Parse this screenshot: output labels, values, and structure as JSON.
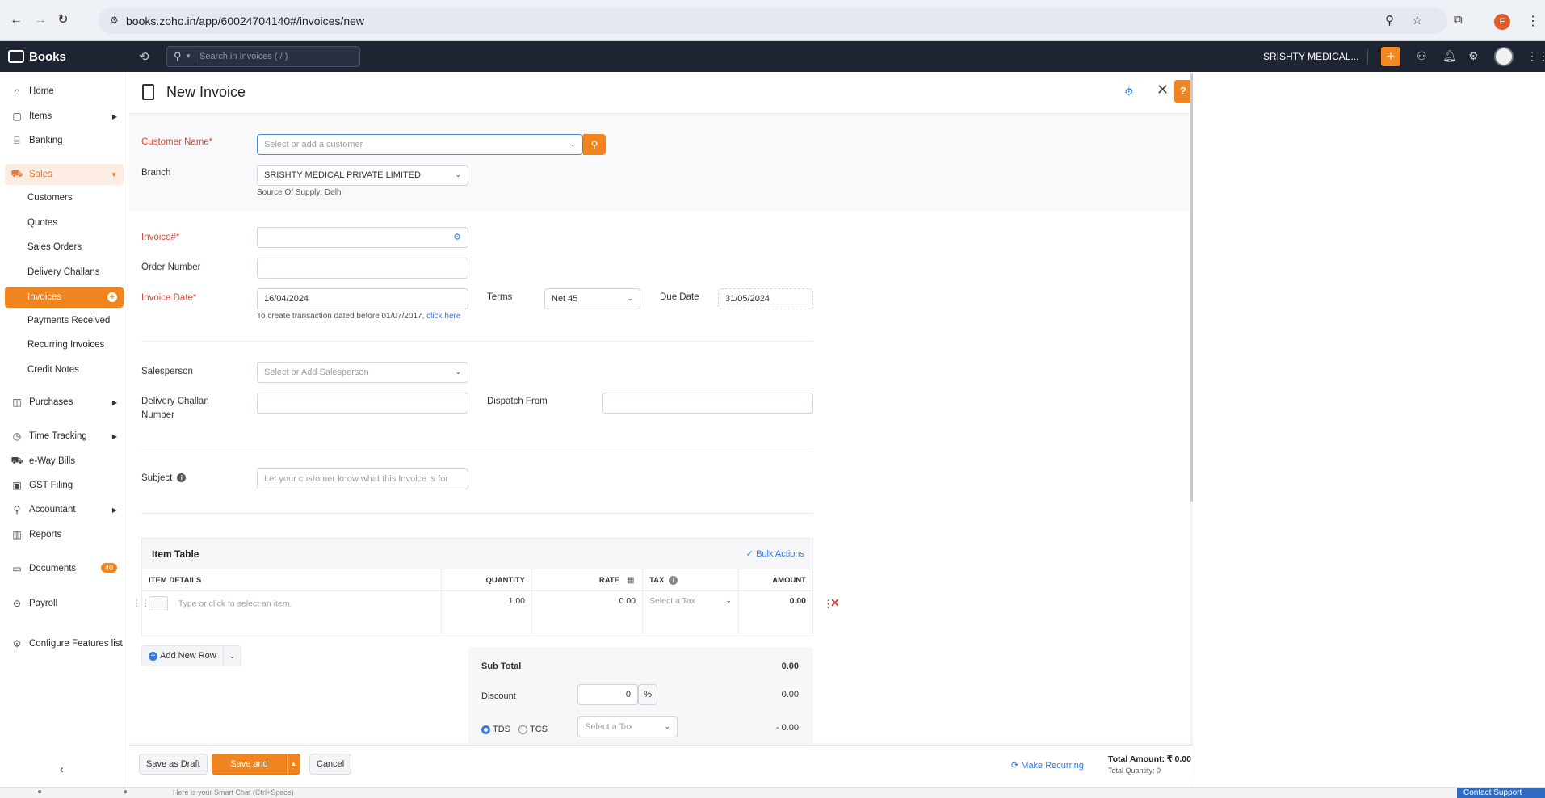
{
  "browser": {
    "url": "books.zoho.in/app/60024704140#/invoices/new",
    "profile_initial": "F"
  },
  "header": {
    "brand": "Books",
    "search_placeholder": "Search in Invoices ( / )",
    "org_name": "SRISHTY MEDICAL...",
    "accent_color": "#f0841e"
  },
  "sidebar": {
    "home": "Home",
    "items": "Items",
    "banking": "Banking",
    "sales": "Sales",
    "sales_sub": [
      "Customers",
      "Quotes",
      "Sales Orders",
      "Delivery Challans"
    ],
    "invoices": "Invoices",
    "sales_sub2": [
      "Payments Received",
      "Recurring Invoices",
      "Credit Notes"
    ],
    "purchases": "Purchases",
    "time_tracking": "Time Tracking",
    "eway": "e-Way Bills",
    "gst": "GST Filing",
    "accountant": "Accountant",
    "reports": "Reports",
    "documents": "Documents",
    "documents_badge": "40",
    "payroll": "Payroll",
    "configure": "Configure Features list"
  },
  "page": {
    "title": "New Invoice"
  },
  "form": {
    "customer_label": "Customer Name*",
    "customer_placeholder": "Select or add a customer",
    "branch_label": "Branch",
    "branch_value": "SRISHTY MEDICAL PRIVATE LIMITED",
    "source_supply": "Source Of Supply: Delhi",
    "invoice_no_label": "Invoice#*",
    "invoice_no_value": "",
    "order_label": "Order Number",
    "order_value": "",
    "invoice_date_label": "Invoice Date*",
    "invoice_date_value": "16/04/2024",
    "date_note": "To create transaction dated before 01/07/2017,",
    "date_note_link": "click here",
    "terms_label": "Terms",
    "terms_value": "Net 45",
    "due_label": "Due Date",
    "due_value": "31/05/2024",
    "salesperson_label": "Salesperson",
    "salesperson_placeholder": "Select or Add Salesperson",
    "challan_label_1": "Delivery Challan",
    "challan_label_2": "Number",
    "dispatch_label": "Dispatch From",
    "subject_label": "Subject",
    "subject_placeholder": "Let your customer know what this Invoice is for"
  },
  "item_table": {
    "title": "Item Table",
    "bulk_actions": "Bulk Actions",
    "columns": [
      "ITEM DETAILS",
      "QUANTITY",
      "RATE",
      "TAX",
      "AMOUNT"
    ],
    "row": {
      "item_placeholder": "Type or click to select an item.",
      "quantity": "1.00",
      "rate": "0.00",
      "tax_placeholder": "Select a Tax",
      "amount": "0.00"
    },
    "add_row": "Add New Row"
  },
  "totals": {
    "subtotal_label": "Sub Total",
    "subtotal_value": "0.00",
    "discount_label": "Discount",
    "discount_input": "0",
    "discount_unit": "%",
    "discount_value": "0.00",
    "tds_label": "TDS",
    "tcs_label": "TCS",
    "tax_select_placeholder": "Select a Tax",
    "tds_value": "- 0.00"
  },
  "footer": {
    "save_draft": "Save as Draft",
    "save_send": "Save and Send",
    "cancel": "Cancel",
    "make_recurring": "Make Recurring",
    "total_amount": "Total Amount: ₹ 0.00",
    "total_quantity": "Total Quantity: 0"
  },
  "status_strip": {
    "smart_chat": "Here is your Smart Chat (Ctrl+Space)",
    "contact_support": "Contact Support"
  }
}
